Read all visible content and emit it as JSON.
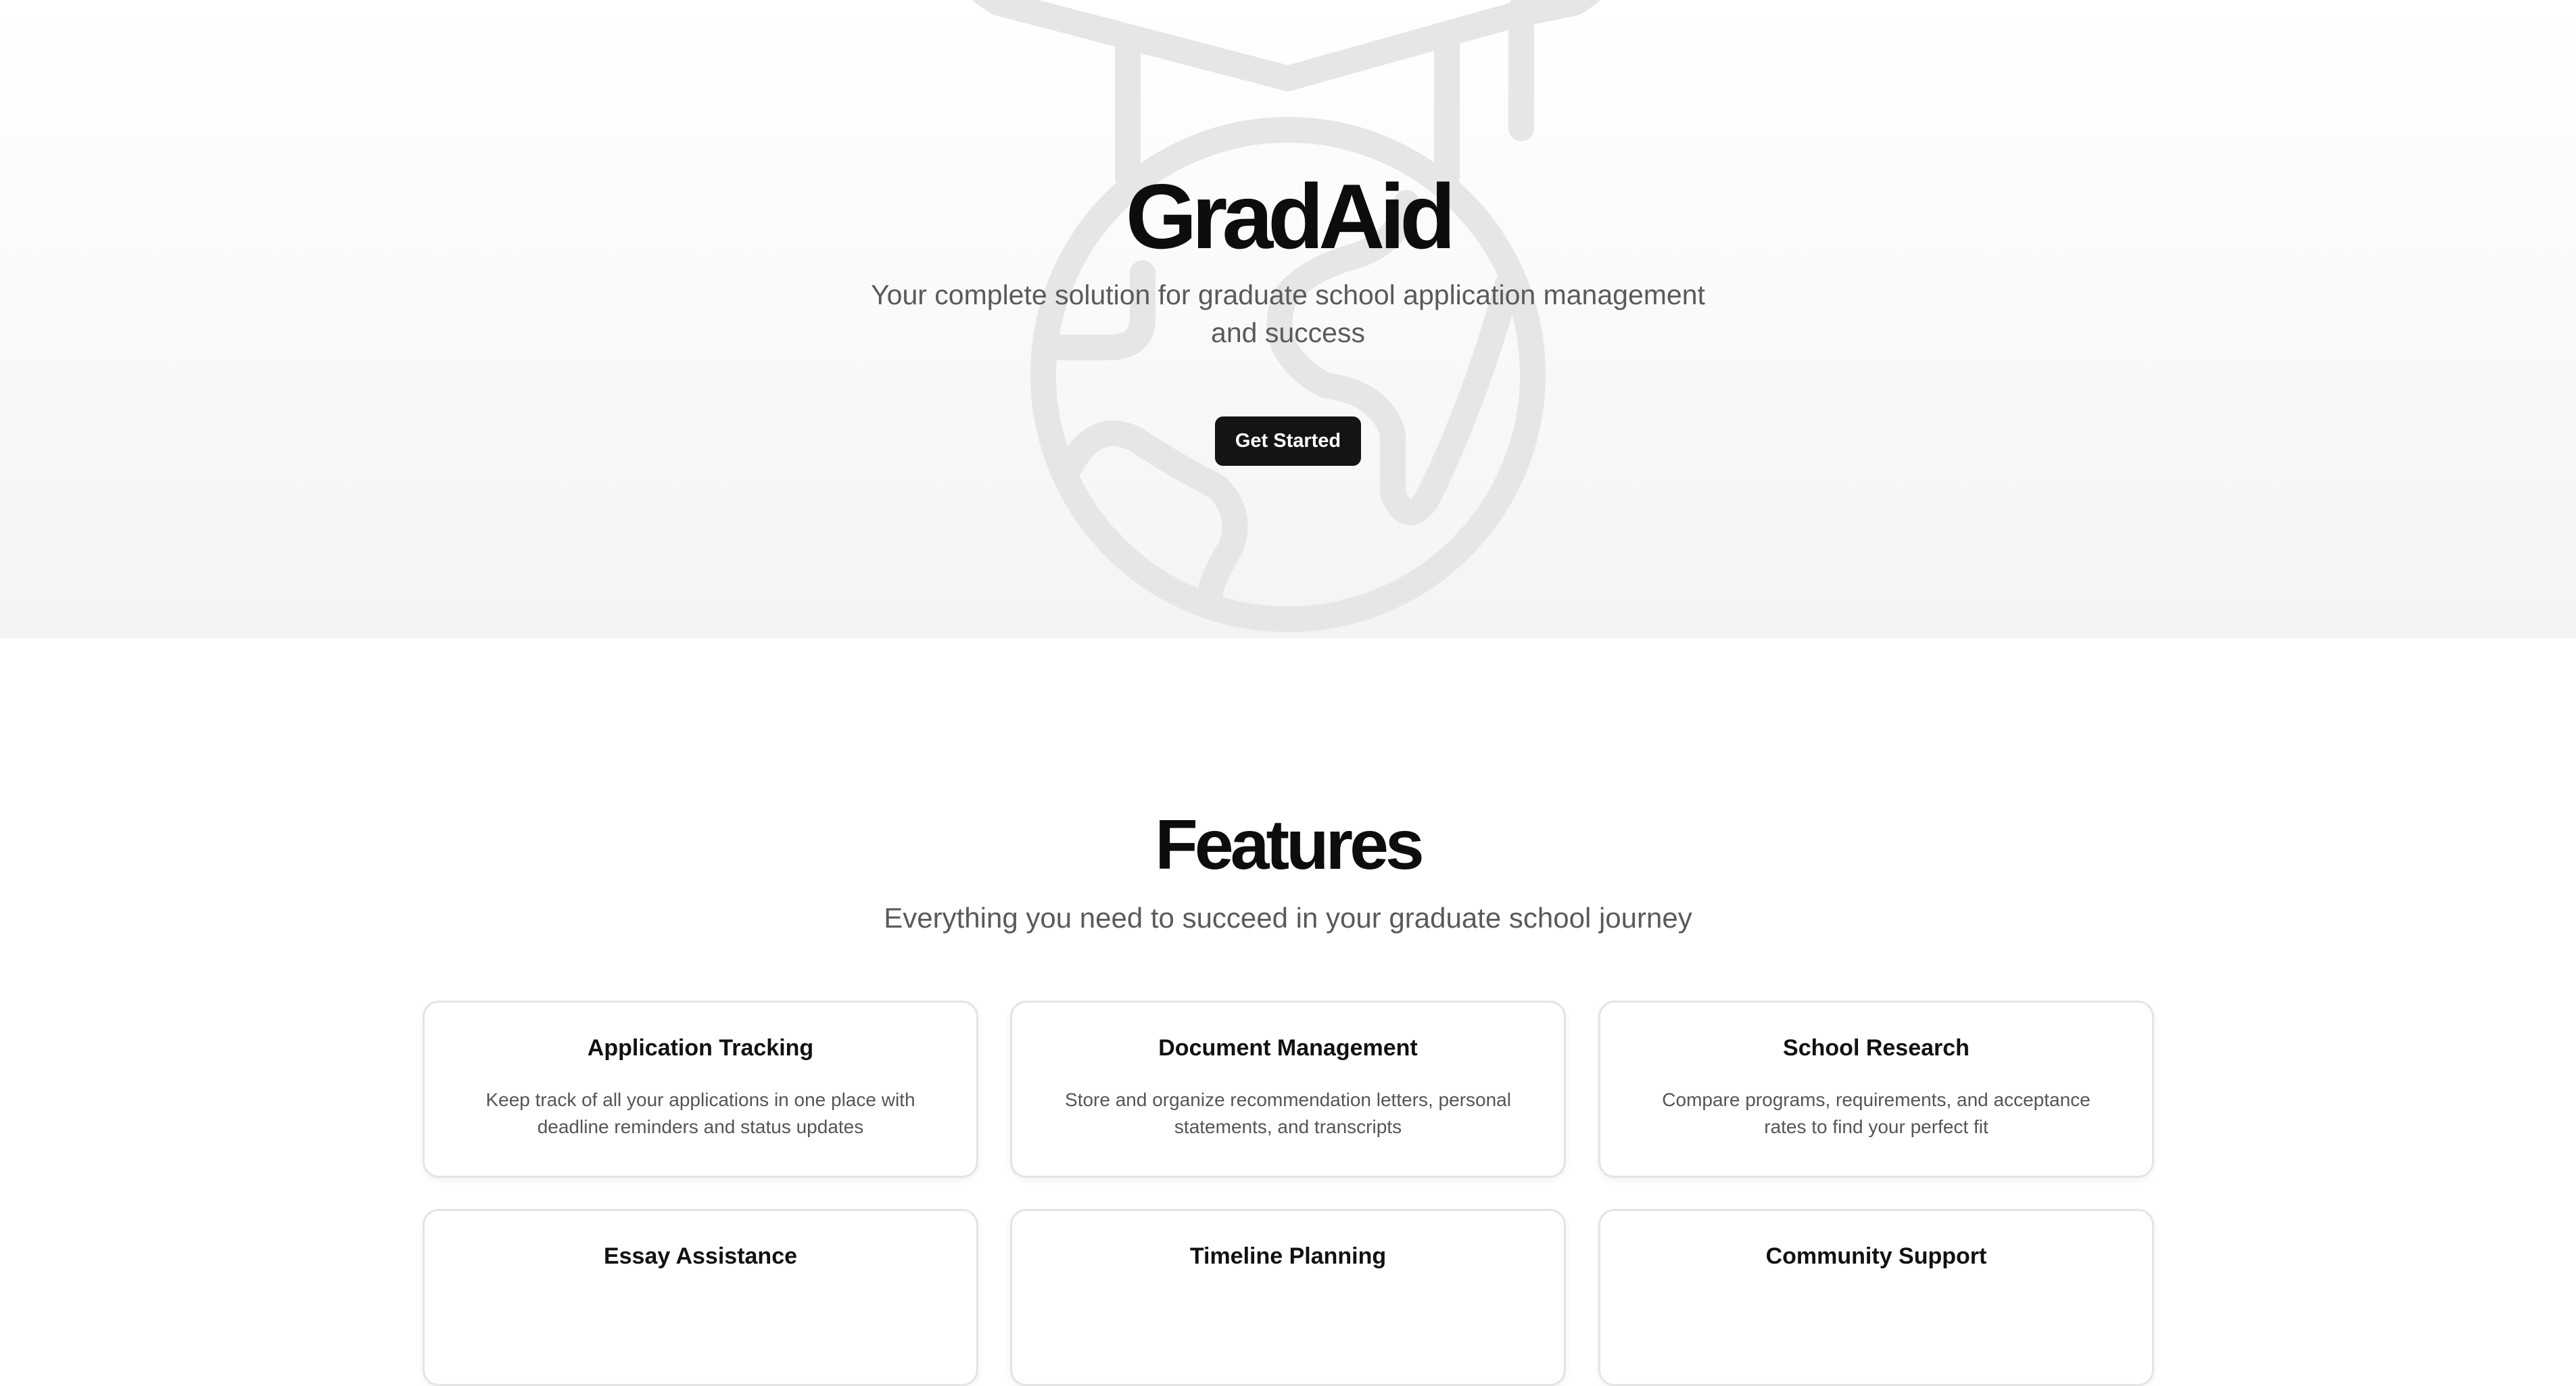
{
  "hero": {
    "title": "GradAid",
    "subtitle": "Your complete solution for graduate school application management and success",
    "cta_label": "Get Started",
    "icon": "graduation-cap-globe-icon"
  },
  "features": {
    "title": "Features",
    "subtitle": "Everything you need to succeed in your graduate school journey",
    "cards": [
      {
        "title": "Application Tracking",
        "description": "Keep track of all your applications in one place with deadline reminders and status updates"
      },
      {
        "title": "Document Management",
        "description": "Store and organize recommendation letters, personal statements, and transcripts"
      },
      {
        "title": "School Research",
        "description": "Compare programs, requirements, and acceptance rates to find your perfect fit"
      },
      {
        "title": "Essay Assistance",
        "description": ""
      },
      {
        "title": "Timeline Planning",
        "description": ""
      },
      {
        "title": "Community Support",
        "description": ""
      }
    ]
  },
  "colors": {
    "primary": "#141414",
    "text_muted": "#5a5a5a",
    "border": "#e4e4e4",
    "hero_bg_start": "#ffffff",
    "hero_bg_end": "#f4f4f4",
    "icon_stroke": "#e6e6e6"
  }
}
